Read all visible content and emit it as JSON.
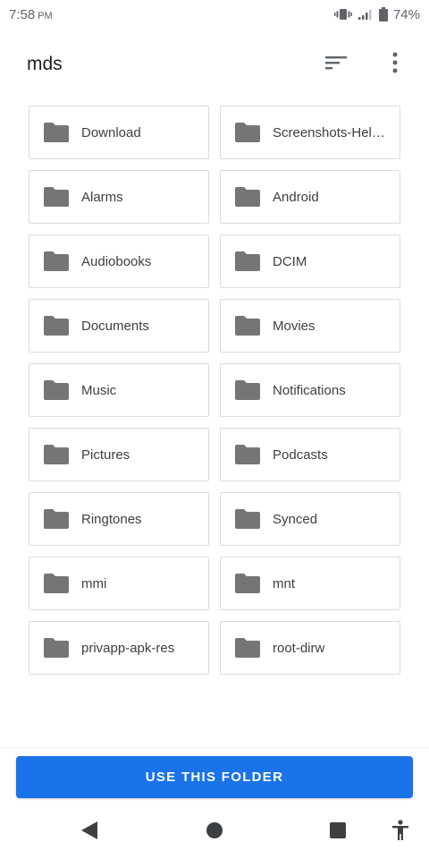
{
  "status_bar": {
    "time": "7:58",
    "ampm": "PM",
    "battery": "74%",
    "icons": [
      "vibrate-icon",
      "signal-icon",
      "battery-icon"
    ]
  },
  "app_bar": {
    "title": "mds",
    "actions": [
      "sort-icon",
      "more-vert-icon"
    ]
  },
  "folders": [
    {
      "name": "Download"
    },
    {
      "name": "Screenshots-Hell…"
    },
    {
      "name": "Alarms"
    },
    {
      "name": "Android"
    },
    {
      "name": "Audiobooks"
    },
    {
      "name": "DCIM"
    },
    {
      "name": "Documents"
    },
    {
      "name": "Movies"
    },
    {
      "name": "Music"
    },
    {
      "name": "Notifications"
    },
    {
      "name": "Pictures"
    },
    {
      "name": "Podcasts"
    },
    {
      "name": "Ringtones"
    },
    {
      "name": "Synced"
    },
    {
      "name": "mmi"
    },
    {
      "name": "mnt"
    },
    {
      "name": "privapp-apk-res"
    },
    {
      "name": "root-dirw"
    }
  ],
  "action": {
    "label": "USE THIS FOLDER"
  },
  "nav_bar": {
    "items": [
      "back-icon",
      "home-icon",
      "recents-icon",
      "accessibility-icon"
    ]
  },
  "colors": {
    "accent": "#1a73e8",
    "folder_icon": "#757575",
    "border": "#dadce0"
  }
}
